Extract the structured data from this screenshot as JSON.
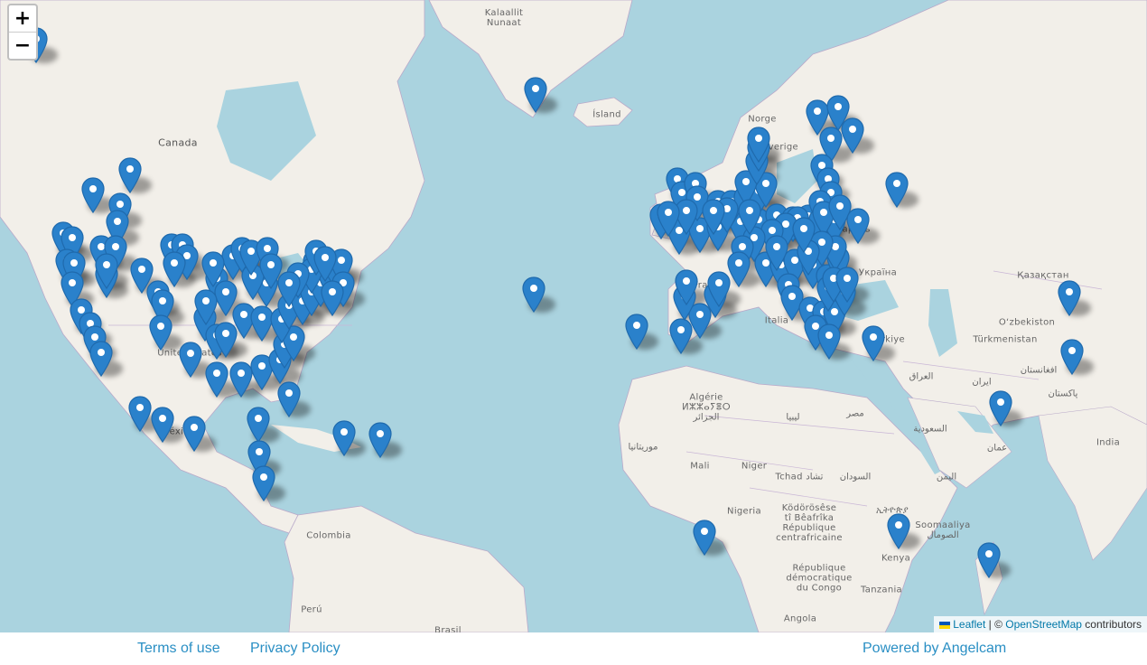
{
  "map": {
    "labels": [
      {
        "text": "Kalaallit\nNunaat",
        "cls": "small"
      },
      {
        "text": "Ísland",
        "cls": "small"
      },
      {
        "text": "Canada",
        "cls": ""
      },
      {
        "text": "Norge",
        "cls": "small"
      },
      {
        "text": "Sverige",
        "cls": "small"
      },
      {
        "text": "Беларусь",
        "cls": "small"
      },
      {
        "text": "Україна",
        "cls": "small"
      },
      {
        "text": "Қазақстан",
        "cls": "small"
      },
      {
        "text": "O‘zbekiston",
        "cls": "small"
      },
      {
        "text": "Türkmenistan",
        "cls": "small"
      },
      {
        "text": "Türkiye",
        "cls": "small"
      },
      {
        "text": "Italia",
        "cls": "small"
      },
      {
        "text": "France",
        "cls": "small"
      },
      {
        "text": "United States",
        "cls": "small"
      },
      {
        "text": "México",
        "cls": "small"
      },
      {
        "text": "Algérie\nⵍⵣⵣⴰⵢⴻⵔ\nالجزائر",
        "cls": "small"
      },
      {
        "text": "ليبيا",
        "cls": "small"
      },
      {
        "text": "مصر",
        "cls": "small"
      },
      {
        "text": "موريتانيا",
        "cls": "small"
      },
      {
        "text": "Mali",
        "cls": "small"
      },
      {
        "text": "Niger",
        "cls": "small"
      },
      {
        "text": "Tchad تشاد",
        "cls": "small"
      },
      {
        "text": "السودان",
        "cls": "small"
      },
      {
        "text": "Nigeria",
        "cls": "small"
      },
      {
        "text": "Ködörösêse\ntî Bêafrîka\nRépublique\ncentrafricaine",
        "cls": "small"
      },
      {
        "text": "République\ndémocratique\ndu Congo",
        "cls": "small"
      },
      {
        "text": "ኢትዮጵያ",
        "cls": "small"
      },
      {
        "text": "Soomaaliya\nالصومال",
        "cls": "small"
      },
      {
        "text": "Kenya",
        "cls": "small"
      },
      {
        "text": "Tanzania",
        "cls": "small"
      },
      {
        "text": "Angola",
        "cls": "small"
      },
      {
        "text": "Colombia",
        "cls": "small"
      },
      {
        "text": "Perú",
        "cls": "small"
      },
      {
        "text": "Brasil",
        "cls": "small"
      },
      {
        "text": "العراق",
        "cls": "small"
      },
      {
        "text": "ایران",
        "cls": "small"
      },
      {
        "text": "افغانستان",
        "cls": "small"
      },
      {
        "text": "پاکستان",
        "cls": "small"
      },
      {
        "text": "India",
        "cls": "small"
      },
      {
        "text": "السعودية",
        "cls": "small"
      },
      {
        "text": "اليمن",
        "cls": "small"
      },
      {
        "text": "عمان",
        "cls": "small"
      }
    ],
    "marker_color": "#2a81cb"
  },
  "controls": {
    "zoom_in": "+",
    "zoom_out": "−"
  },
  "attribution": {
    "leaflet": "Leaflet",
    "sep": " | © ",
    "osm": "OpenStreetMap",
    "suffix": " contributors"
  },
  "footer": {
    "terms": "Terms of use",
    "privacy": "Privacy Policy",
    "powered": "Powered by Angelcam"
  }
}
